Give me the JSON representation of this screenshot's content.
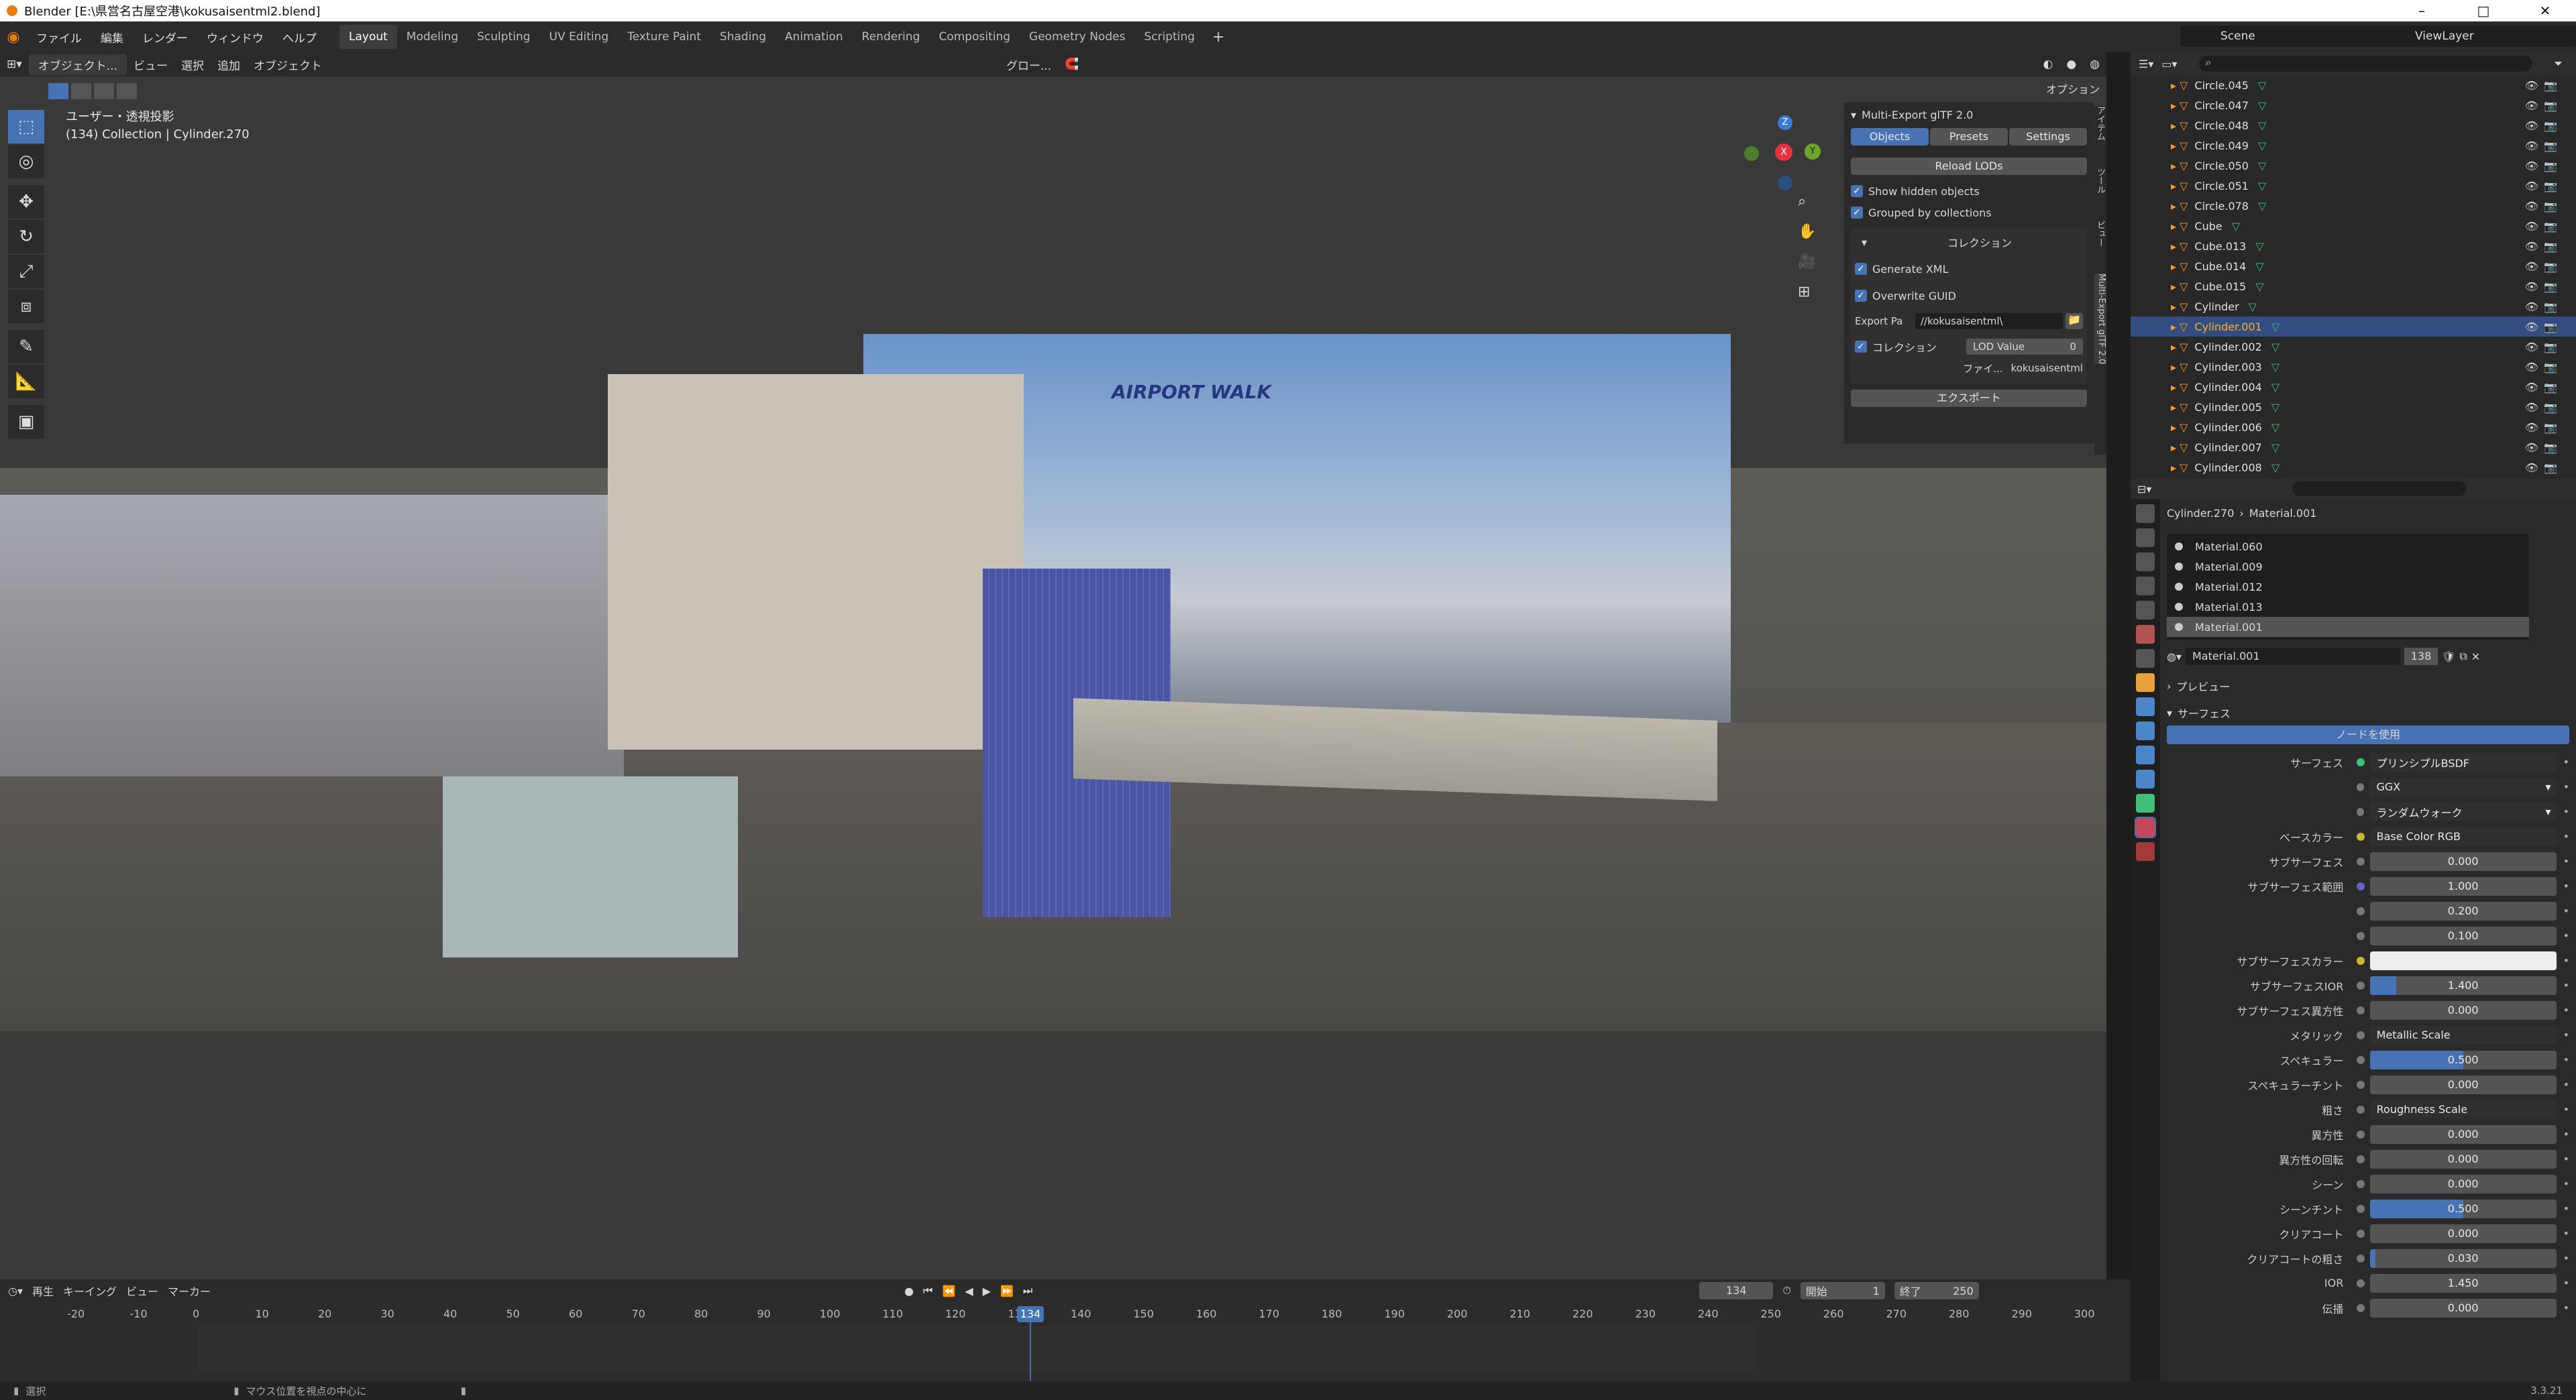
{
  "title_bar": {
    "title": "Blender [E:\\県営名古屋空港\\kokusaisentml2.blend]"
  },
  "menu": [
    "ファイル",
    "編集",
    "レンダー",
    "ウィンドウ",
    "ヘルプ"
  ],
  "workspaces": [
    "Layout",
    "Modeling",
    "Sculpting",
    "UV Editing",
    "Texture Paint",
    "Shading",
    "Animation",
    "Rendering",
    "Compositing",
    "Geometry Nodes",
    "Scripting"
  ],
  "active_workspace": "Layout",
  "scene": "Scene",
  "view_layer": "ViewLayer",
  "viewport": {
    "mode": "オブジェクト...",
    "header_menus": [
      "ビュー",
      "選択",
      "追加",
      "オブジェクト"
    ],
    "transform": "グロー...",
    "options": "オプション",
    "info_line1": "ユーザー・透視投影",
    "info_line2": "(134) Collection | Cylinder.270",
    "photo_sign": "AIRPORT WALK"
  },
  "npanel": {
    "header": "Multi-Export glTF 2.0",
    "tabs": [
      "Objects",
      "Presets",
      "Settings"
    ],
    "active_tab": "Objects",
    "reload": "Reload LODs",
    "show_hidden": "Show hidden objects",
    "grouped": "Grouped by collections",
    "collection_header": "コレクション",
    "generate_xml": "Generate XML",
    "overwrite_guid": "Overwrite GUID",
    "export_path_label": "Export Pa",
    "export_path": "//kokusaisentml\\",
    "collection_label": "コレクション",
    "lod_label": "LOD Value",
    "lod_value": "0",
    "file_label": "ファイ...",
    "file_value": "kokusaisentml",
    "export_button": "エクスポート",
    "side_tabs": [
      "Multi-Export glTF 2.0",
      "ビュー",
      "ツール",
      "アイテム"
    ]
  },
  "outliner": {
    "items": [
      "Circle.045",
      "Circle.047",
      "Circle.048",
      "Circle.049",
      "Circle.050",
      "Circle.051",
      "Circle.078",
      "Cube",
      "Cube.013",
      "Cube.014",
      "Cube.015",
      "Cylinder",
      "Cylinder.001",
      "Cylinder.002",
      "Cylinder.003",
      "Cylinder.004",
      "Cylinder.005",
      "Cylinder.006",
      "Cylinder.007",
      "Cylinder.008"
    ],
    "selected": "Cylinder.001"
  },
  "properties": {
    "breadcrumb_object": "Cylinder.270",
    "breadcrumb_material": "Material.001",
    "slots": [
      "Material.060",
      "Material.009",
      "Material.012",
      "Material.013",
      "Material.001"
    ],
    "active_slot": "Material.001",
    "material_name": "Material.001",
    "users": "138",
    "preview": "プレビュー",
    "surface_header": "サーフェス",
    "use_nodes": "ノードを使用",
    "rows": [
      {
        "label": "サーフェス",
        "value": "プリンシプルBSDF",
        "kind": "link",
        "dot": "#3fbf7a"
      },
      {
        "label": "",
        "value": "GGX",
        "kind": "select"
      },
      {
        "label": "",
        "value": "ランダムウォーク",
        "kind": "select"
      },
      {
        "label": "ベースカラー",
        "value": "Base Color RGB",
        "kind": "link",
        "dot": "#c7b932"
      },
      {
        "label": "サブサーフェス",
        "value": "0.000",
        "kind": "num",
        "fill": 0
      },
      {
        "label": "サブサーフェス範囲",
        "value": "1.000",
        "kind": "num",
        "fill": 0,
        "dot": "#6363c7"
      },
      {
        "label": "",
        "value": "0.200",
        "kind": "num",
        "fill": 0
      },
      {
        "label": "",
        "value": "0.100",
        "kind": "num",
        "fill": 0
      },
      {
        "label": "サブサーフェスカラー",
        "value": "",
        "kind": "color",
        "dot": "#c7b932"
      },
      {
        "label": "サブサーフェスIOR",
        "value": "1.400",
        "kind": "num",
        "fill": 0.14
      },
      {
        "label": "サブサーフェス異方性",
        "value": "0.000",
        "kind": "num",
        "fill": 0
      },
      {
        "label": "メタリック",
        "value": "Metallic Scale",
        "kind": "link"
      },
      {
        "label": "スペキュラー",
        "value": "0.500",
        "kind": "num",
        "fill": 0.5
      },
      {
        "label": "スペキュラーチント",
        "value": "0.000",
        "kind": "num",
        "fill": 0
      },
      {
        "label": "粗さ",
        "value": "Roughness Scale",
        "kind": "link"
      },
      {
        "label": "異方性",
        "value": "0.000",
        "kind": "num",
        "fill": 0
      },
      {
        "label": "異方性の回転",
        "value": "0.000",
        "kind": "num",
        "fill": 0
      },
      {
        "label": "シーン",
        "value": "0.000",
        "kind": "num",
        "fill": 0
      },
      {
        "label": "シーンチント",
        "value": "0.500",
        "kind": "num",
        "fill": 0.5
      },
      {
        "label": "クリアコート",
        "value": "0.000",
        "kind": "num",
        "fill": 0
      },
      {
        "label": "クリアコートの粗さ",
        "value": "0.030",
        "kind": "num",
        "fill": 0.03
      },
      {
        "label": "IOR",
        "value": "1.450",
        "kind": "num",
        "fill": 0
      },
      {
        "label": "伝播",
        "value": "0.000",
        "kind": "num",
        "fill": 0
      }
    ]
  },
  "timeline": {
    "menus": [
      "再生",
      "キーイング",
      "ビュー",
      "マーカー"
    ],
    "current_frame": "134",
    "start_label": "開始",
    "start": "1",
    "end_label": "終了",
    "end": "250",
    "ticks": [
      "-20",
      "-10",
      "0",
      "10",
      "20",
      "30",
      "40",
      "50",
      "60",
      "70",
      "80",
      "90",
      "100",
      "110",
      "120",
      "130",
      "140",
      "150",
      "160",
      "170",
      "180",
      "190",
      "200",
      "210",
      "220",
      "230",
      "240",
      "250",
      "260",
      "270",
      "280",
      "290",
      "300"
    ]
  },
  "status": {
    "left": "選択",
    "middle": "マウス位置を視点の中心に",
    "version": "3.3.21"
  },
  "colors": {
    "accent": "#4772b3",
    "selected_text": "#ffaf29",
    "mesh_icon": "#3fbf7a",
    "object_icon": "#ff9a2b"
  }
}
